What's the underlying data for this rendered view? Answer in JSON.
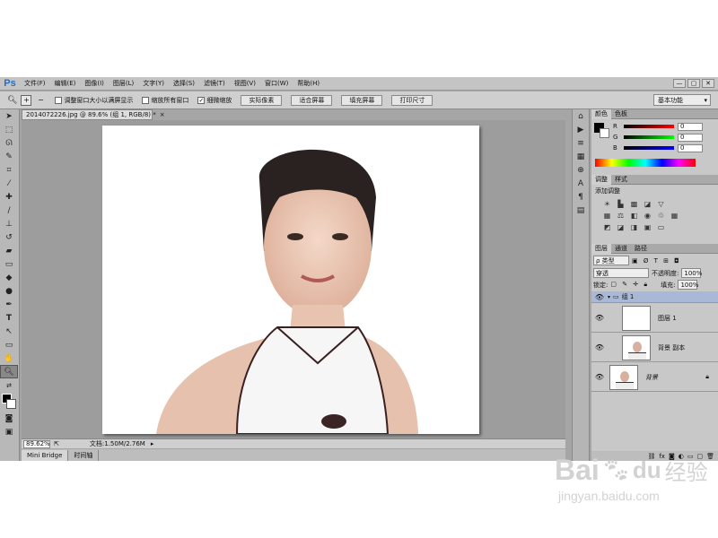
{
  "app": {
    "logo": "Ps"
  },
  "menu": [
    "文件(F)",
    "编辑(E)",
    "图像(I)",
    "图层(L)",
    "文字(Y)",
    "选择(S)",
    "滤镜(T)",
    "视图(V)",
    "窗口(W)",
    "帮助(H)"
  ],
  "window_controls": [
    "—",
    "▢",
    "✕"
  ],
  "options": {
    "checkbox1": "调整窗口大小以满屏显示",
    "checkbox2": "缩放所有窗口",
    "checkbox3": "细微缩放",
    "checkbox3_checked": "✓",
    "btn_actual": "实际像素",
    "btn_fit": "适合屏幕",
    "btn_fill": "填充屏幕",
    "btn_print": "打印尺寸",
    "workspace": "基本功能"
  },
  "document": {
    "tab_title": "2014072226.jpg @ 89.6% (组 1, RGB/8) *",
    "close": "×"
  },
  "status": {
    "zoom": "89.62%",
    "doc_size": "文档:1.50M/2.76M"
  },
  "bottom_tabs": [
    "Mini Bridge",
    "时间轴"
  ],
  "color_panel": {
    "tabs": [
      "颜色",
      "色板"
    ],
    "channels": [
      {
        "label": "R",
        "value": "0"
      },
      {
        "label": "G",
        "value": "0"
      },
      {
        "label": "B",
        "value": "0"
      }
    ]
  },
  "adjust_panel": {
    "tabs": [
      "调整",
      "样式"
    ],
    "title": "添加调整"
  },
  "layers_panel": {
    "tabs": [
      "图层",
      "通道",
      "路径"
    ],
    "filter_kind": "ρ 类型",
    "blend_mode": "穿透",
    "opacity_label": "不透明度:",
    "opacity_value": "100%",
    "lock_label": "锁定:",
    "fill_label": "填充:",
    "fill_value": "100%",
    "layers": [
      {
        "name": "组 1"
      },
      {
        "name": "图层 1"
      },
      {
        "name": "背景 副本"
      },
      {
        "name": "背景"
      }
    ]
  },
  "watermark": {
    "brand": "Bai",
    "brand2": "du",
    "sub": "经验",
    "url": "jingyan.baidu.com"
  },
  "colors": {
    "accent": "#2a6fb8",
    "selected_layer": "#aab8d8"
  }
}
